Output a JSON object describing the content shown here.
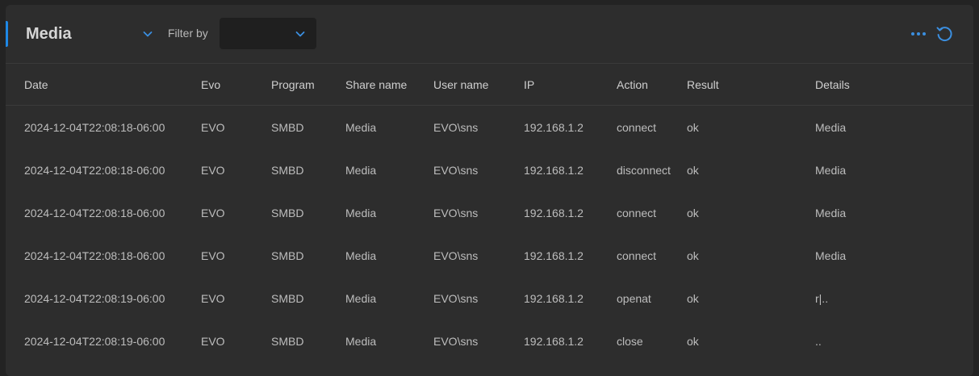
{
  "header": {
    "title": "Media",
    "filter_label": "Filter by",
    "filter_value": "",
    "icons": {
      "title_dropdown": "chevron-down-icon",
      "filter_dropdown": "chevron-down-icon",
      "more": "more-horizontal-icon",
      "refresh": "refresh-icon"
    },
    "accent_color": "#1e88e5"
  },
  "table": {
    "columns": [
      "Date",
      "Evo",
      "Program",
      "Share name",
      "User name",
      "IP",
      "Action",
      "Result",
      "Details"
    ],
    "rows": [
      [
        "2024-12-04T22:08:18-06:00",
        "EVO",
        "SMBD",
        "Media",
        "EVO\\sns",
        "192.168.1.2",
        "connect",
        "ok",
        "Media"
      ],
      [
        "2024-12-04T22:08:18-06:00",
        "EVO",
        "SMBD",
        "Media",
        "EVO\\sns",
        "192.168.1.2",
        "disconnect",
        "ok",
        "Media"
      ],
      [
        "2024-12-04T22:08:18-06:00",
        "EVO",
        "SMBD",
        "Media",
        "EVO\\sns",
        "192.168.1.2",
        "connect",
        "ok",
        "Media"
      ],
      [
        "2024-12-04T22:08:18-06:00",
        "EVO",
        "SMBD",
        "Media",
        "EVO\\sns",
        "192.168.1.2",
        "connect",
        "ok",
        "Media"
      ],
      [
        "2024-12-04T22:08:19-06:00",
        "EVO",
        "SMBD",
        "Media",
        "EVO\\sns",
        "192.168.1.2",
        "openat",
        "ok",
        "r|.."
      ],
      [
        "2024-12-04T22:08:19-06:00",
        "EVO",
        "SMBD",
        "Media",
        "EVO\\sns",
        "192.168.1.2",
        "close",
        "ok",
        ".."
      ]
    ]
  }
}
